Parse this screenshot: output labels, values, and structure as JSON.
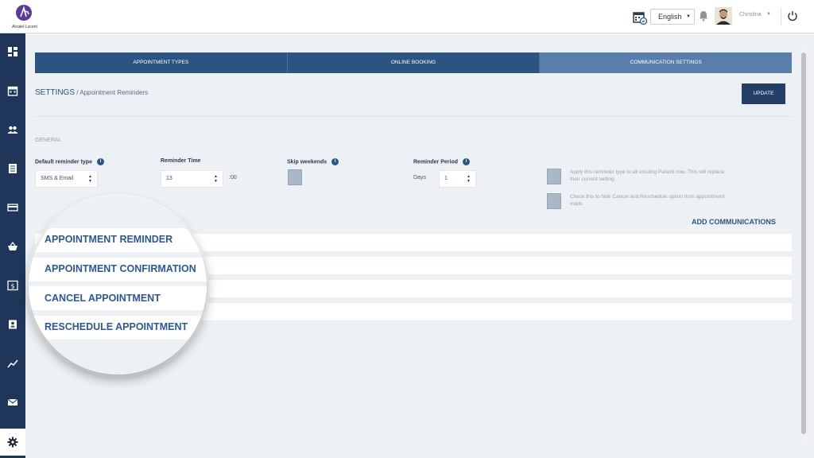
{
  "header": {
    "logo_text": "Alcatel·Lucent",
    "language": "English",
    "user_name": "Christina"
  },
  "sidebar": {
    "items": [
      {
        "name": "dashboard-icon"
      },
      {
        "name": "calendar-icon"
      },
      {
        "name": "patients-icon"
      },
      {
        "name": "document-icon"
      },
      {
        "name": "card-icon"
      },
      {
        "name": "basket-icon"
      },
      {
        "name": "dollar-icon"
      },
      {
        "name": "contact-icon"
      },
      {
        "name": "chart-line-icon"
      },
      {
        "name": "mail-icon"
      },
      {
        "name": "gear-icon",
        "active": true
      }
    ]
  },
  "tabs": [
    "APPOINTMENT TYPES",
    "ONLINE BOOKING",
    "COMMUNICATION SETTINGS"
  ],
  "breadcrumb": {
    "title": "SETTINGS",
    "separator": " / ",
    "sub": "Appointment Reminders"
  },
  "update_label": "UPDATE",
  "general": {
    "section_label": "GENERAL",
    "reminder_type_label": "Default reminder type",
    "reminder_type_value": "SMS & Email",
    "reminder_time_label": "Reminder Time",
    "reminder_time_value": "13",
    "reminder_time_suffix": ":00",
    "skip_weekends_label": "Skip weekends",
    "reminder_period_label": "Reminder Period",
    "reminder_period_unit": "Days",
    "reminder_period_value": "1",
    "apply_note": "Apply this reminder type to all existing Patient now. This will replace their current setting.",
    "hide_note": "Check this to hide Cancel and Reschedule option from appointment mails."
  },
  "add_communications_label": "ADD COMMUNICATIONS",
  "communications": [
    "APPOINTMENT REMINDER",
    "APPOINTMENT CONFIRMATION",
    "CANCEL APPOINTMENT",
    "RESCHEDULE APPOINTMENT"
  ],
  "colors": {
    "sidebar": "#1f3559",
    "tab": "#2c5483",
    "tab_active": "#5a7eab",
    "accent": "#253e66"
  }
}
